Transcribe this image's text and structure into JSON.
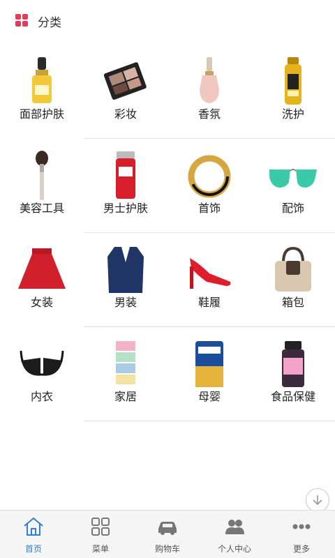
{
  "header": {
    "title": "分类",
    "logo_color": "#e23b5b"
  },
  "categories": [
    {
      "label": "面部护肤",
      "icon": "serum-bottle-icon"
    },
    {
      "label": "彩妆",
      "icon": "eyeshadow-palette-icon"
    },
    {
      "label": "香氛",
      "icon": "perfume-bottle-icon"
    },
    {
      "label": "洗护",
      "icon": "shampoo-bottle-icon"
    },
    {
      "label": "美容工具",
      "icon": "makeup-brush-icon"
    },
    {
      "label": "男士护肤",
      "icon": "men-skincare-can-icon"
    },
    {
      "label": "首饰",
      "icon": "bracelet-icon"
    },
    {
      "label": "配饰",
      "icon": "sunglasses-icon"
    },
    {
      "label": "女装",
      "icon": "skirt-icon"
    },
    {
      "label": "男装",
      "icon": "blazer-icon"
    },
    {
      "label": "鞋履",
      "icon": "high-heel-icon"
    },
    {
      "label": "箱包",
      "icon": "handbag-icon"
    },
    {
      "label": "内衣",
      "icon": "bra-icon"
    },
    {
      "label": "家居",
      "icon": "storage-drawers-icon"
    },
    {
      "label": "母婴",
      "icon": "formula-can-icon"
    },
    {
      "label": "食品保健",
      "icon": "supplement-bottle-icon"
    }
  ],
  "tabs": [
    {
      "label": "首页",
      "icon": "home-icon",
      "active": true
    },
    {
      "label": "菜单",
      "icon": "grid-menu-icon",
      "active": false
    },
    {
      "label": "购物车",
      "icon": "car-icon",
      "active": false
    },
    {
      "label": "个人中心",
      "icon": "people-icon",
      "active": false
    },
    {
      "label": "更多",
      "icon": "more-dots-icon",
      "active": false
    }
  ],
  "colors": {
    "accent": "#2f7fd0",
    "tab_inactive": "#555555"
  }
}
